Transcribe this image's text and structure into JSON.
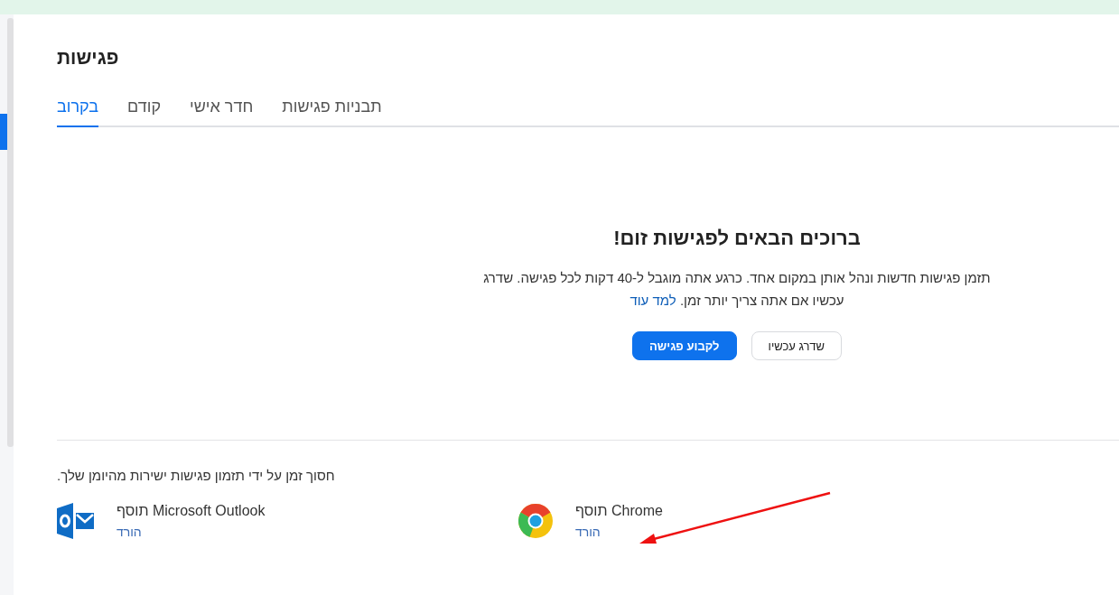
{
  "page": {
    "title": "פגישות"
  },
  "tabs": [
    {
      "label": "תבניות פגישות",
      "selected": false
    },
    {
      "label": "חדר אישי",
      "selected": false
    },
    {
      "label": "קודם",
      "selected": false
    },
    {
      "label": "בקרוב",
      "selected": true
    }
  ],
  "welcome": {
    "title": "ברוכים הבאים לפגישות זום!",
    "body": "תזמן פגישות חדשות ונהל אותן במקום אחד. כרגע אתה מוגבל ל-40 דקות לכל פגישה. שדרג עכשיו אם אתה צריך יותר זמן.",
    "link": "למד עוד",
    "buttons": [
      {
        "label": "שדרג עכשיו",
        "kind": "secondary"
      },
      {
        "label": "לקבוע פגישה",
        "kind": "primary"
      }
    ]
  },
  "integrations": {
    "intro": "חסוך זמן על ידי תזמון פגישות ישירות מהיומן שלך.",
    "items": [
      {
        "kind": "chrome",
        "name": "תוסף Chrome",
        "link": "הורד"
      },
      {
        "kind": "outlook",
        "name": "תוסף Microsoft Outlook",
        "link": "הורד"
      }
    ]
  },
  "annotation_arrow": {
    "color": "#ee1111"
  }
}
